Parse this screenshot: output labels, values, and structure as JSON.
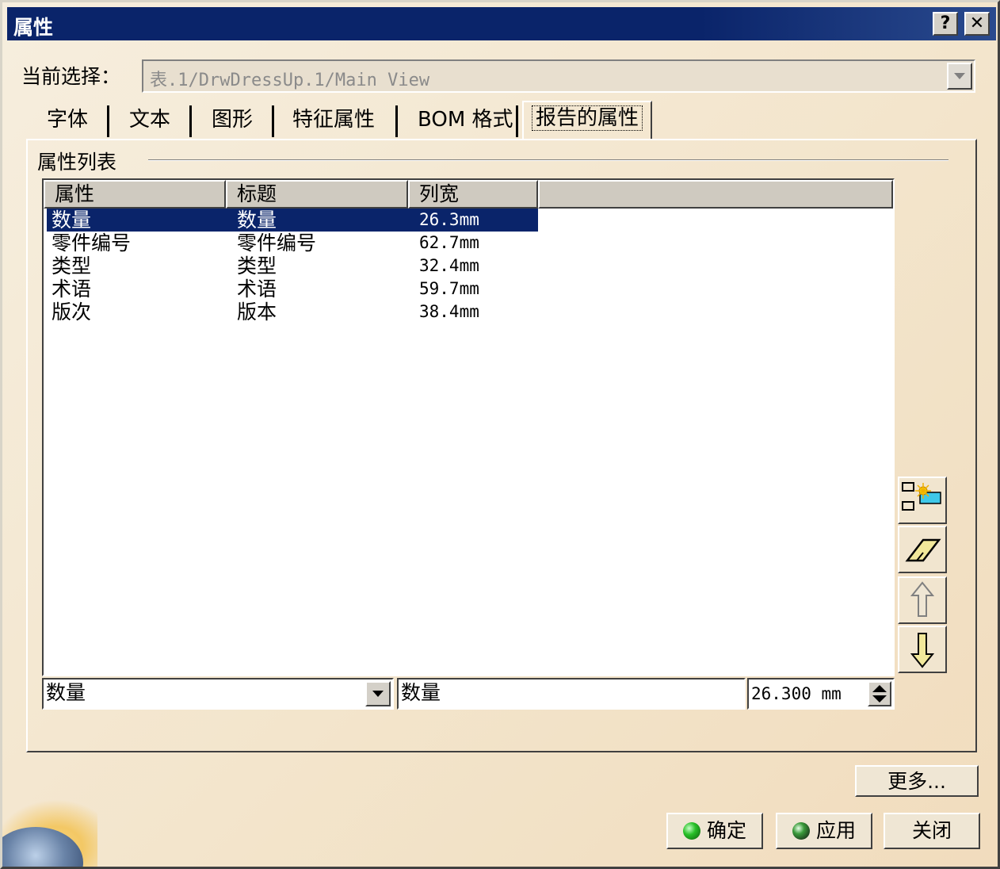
{
  "window": {
    "title": "属性"
  },
  "titlebar": {
    "help_label": "?",
    "close_label": "✕"
  },
  "selection": {
    "label": "当前选择：",
    "value": "表.1/DrwDressUp.1/Main View"
  },
  "tabs": [
    {
      "label": "字体"
    },
    {
      "label": "文本"
    },
    {
      "label": "图形"
    },
    {
      "label": "特征属性"
    },
    {
      "label": "BOM 格式"
    },
    {
      "label": "报告的属性",
      "active": true
    }
  ],
  "group": {
    "label": "属性列表"
  },
  "list": {
    "columns": [
      "属性",
      "标题",
      "列宽"
    ],
    "rows": [
      {
        "property": "数量",
        "title": "数量",
        "width": "26.3mm",
        "selected": true
      },
      {
        "property": "零件编号",
        "title": "零件编号",
        "width": "62.7mm"
      },
      {
        "property": "类型",
        "title": "类型",
        "width": "32.4mm"
      },
      {
        "property": "术语",
        "title": "术语",
        "width": "59.7mm"
      },
      {
        "property": "版次",
        "title": "版本",
        "width": "38.4mm"
      }
    ]
  },
  "side_buttons": [
    {
      "icon": "insert-column-icon"
    },
    {
      "icon": "eraser-icon"
    },
    {
      "icon": "arrow-up-icon"
    },
    {
      "icon": "arrow-down-icon"
    }
  ],
  "editor": {
    "property_value": "数量",
    "title_value": "数量",
    "width_value": "26.300 mm"
  },
  "buttons": {
    "more": "更多...",
    "ok": "确定",
    "apply": "应用",
    "close": "关闭"
  },
  "colors": {
    "titlebar": "#0a246a",
    "selection": "#0a246a",
    "background": "#f3e5cc"
  }
}
